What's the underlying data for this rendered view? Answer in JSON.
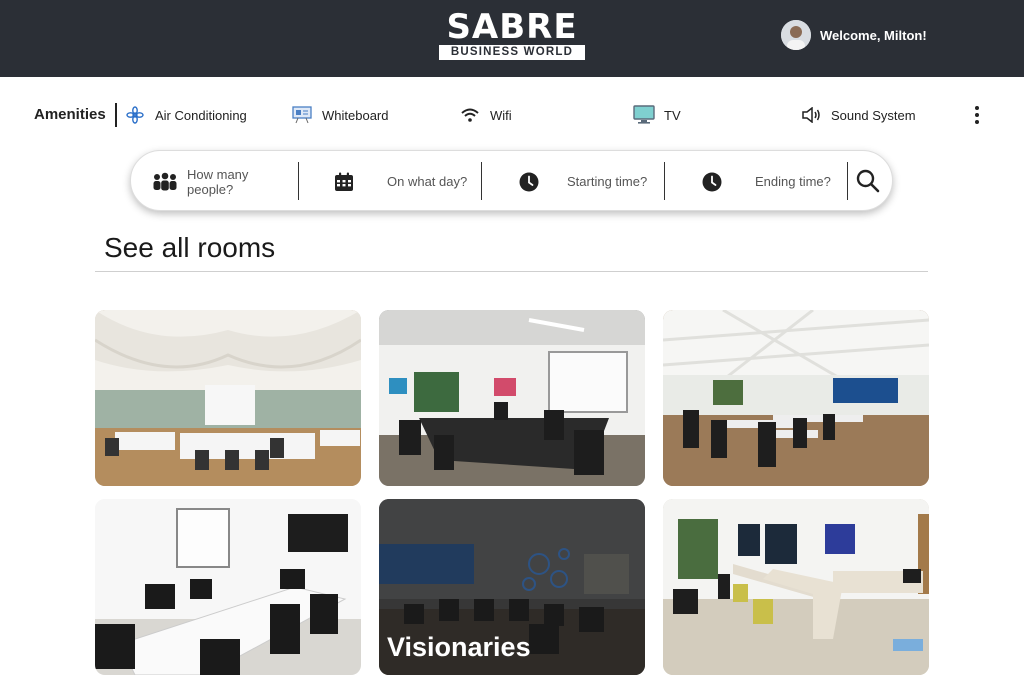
{
  "header": {
    "logo_text": "SABRE",
    "logo_subtext": "BUSINESS WORLD",
    "welcome_text": "Welcome, Milton!"
  },
  "amenities": {
    "title": "Amenities",
    "items": [
      {
        "label": "Air Conditioning",
        "icon": "air-conditioning-icon"
      },
      {
        "label": "Whiteboard",
        "icon": "whiteboard-icon"
      },
      {
        "label": "Wifi",
        "icon": "wifi-icon"
      },
      {
        "label": "TV",
        "icon": "tv-icon"
      },
      {
        "label": "Sound System",
        "icon": "sound-system-icon"
      }
    ],
    "more_icon": "more-vertical-icon"
  },
  "search": {
    "people_placeholder": "How many people?",
    "day_placeholder": "On what day?",
    "start_placeholder": "Starting time?",
    "end_placeholder": "Ending time?"
  },
  "rooms_section": {
    "title": "See all rooms",
    "rooms": [
      {
        "name": ""
      },
      {
        "name": ""
      },
      {
        "name": ""
      },
      {
        "name": ""
      },
      {
        "name": "Visionaries"
      },
      {
        "name": ""
      }
    ]
  },
  "colors": {
    "header_bg": "#2b2f36",
    "text": "#222222",
    "accent_blue": "#2a6fc9"
  }
}
